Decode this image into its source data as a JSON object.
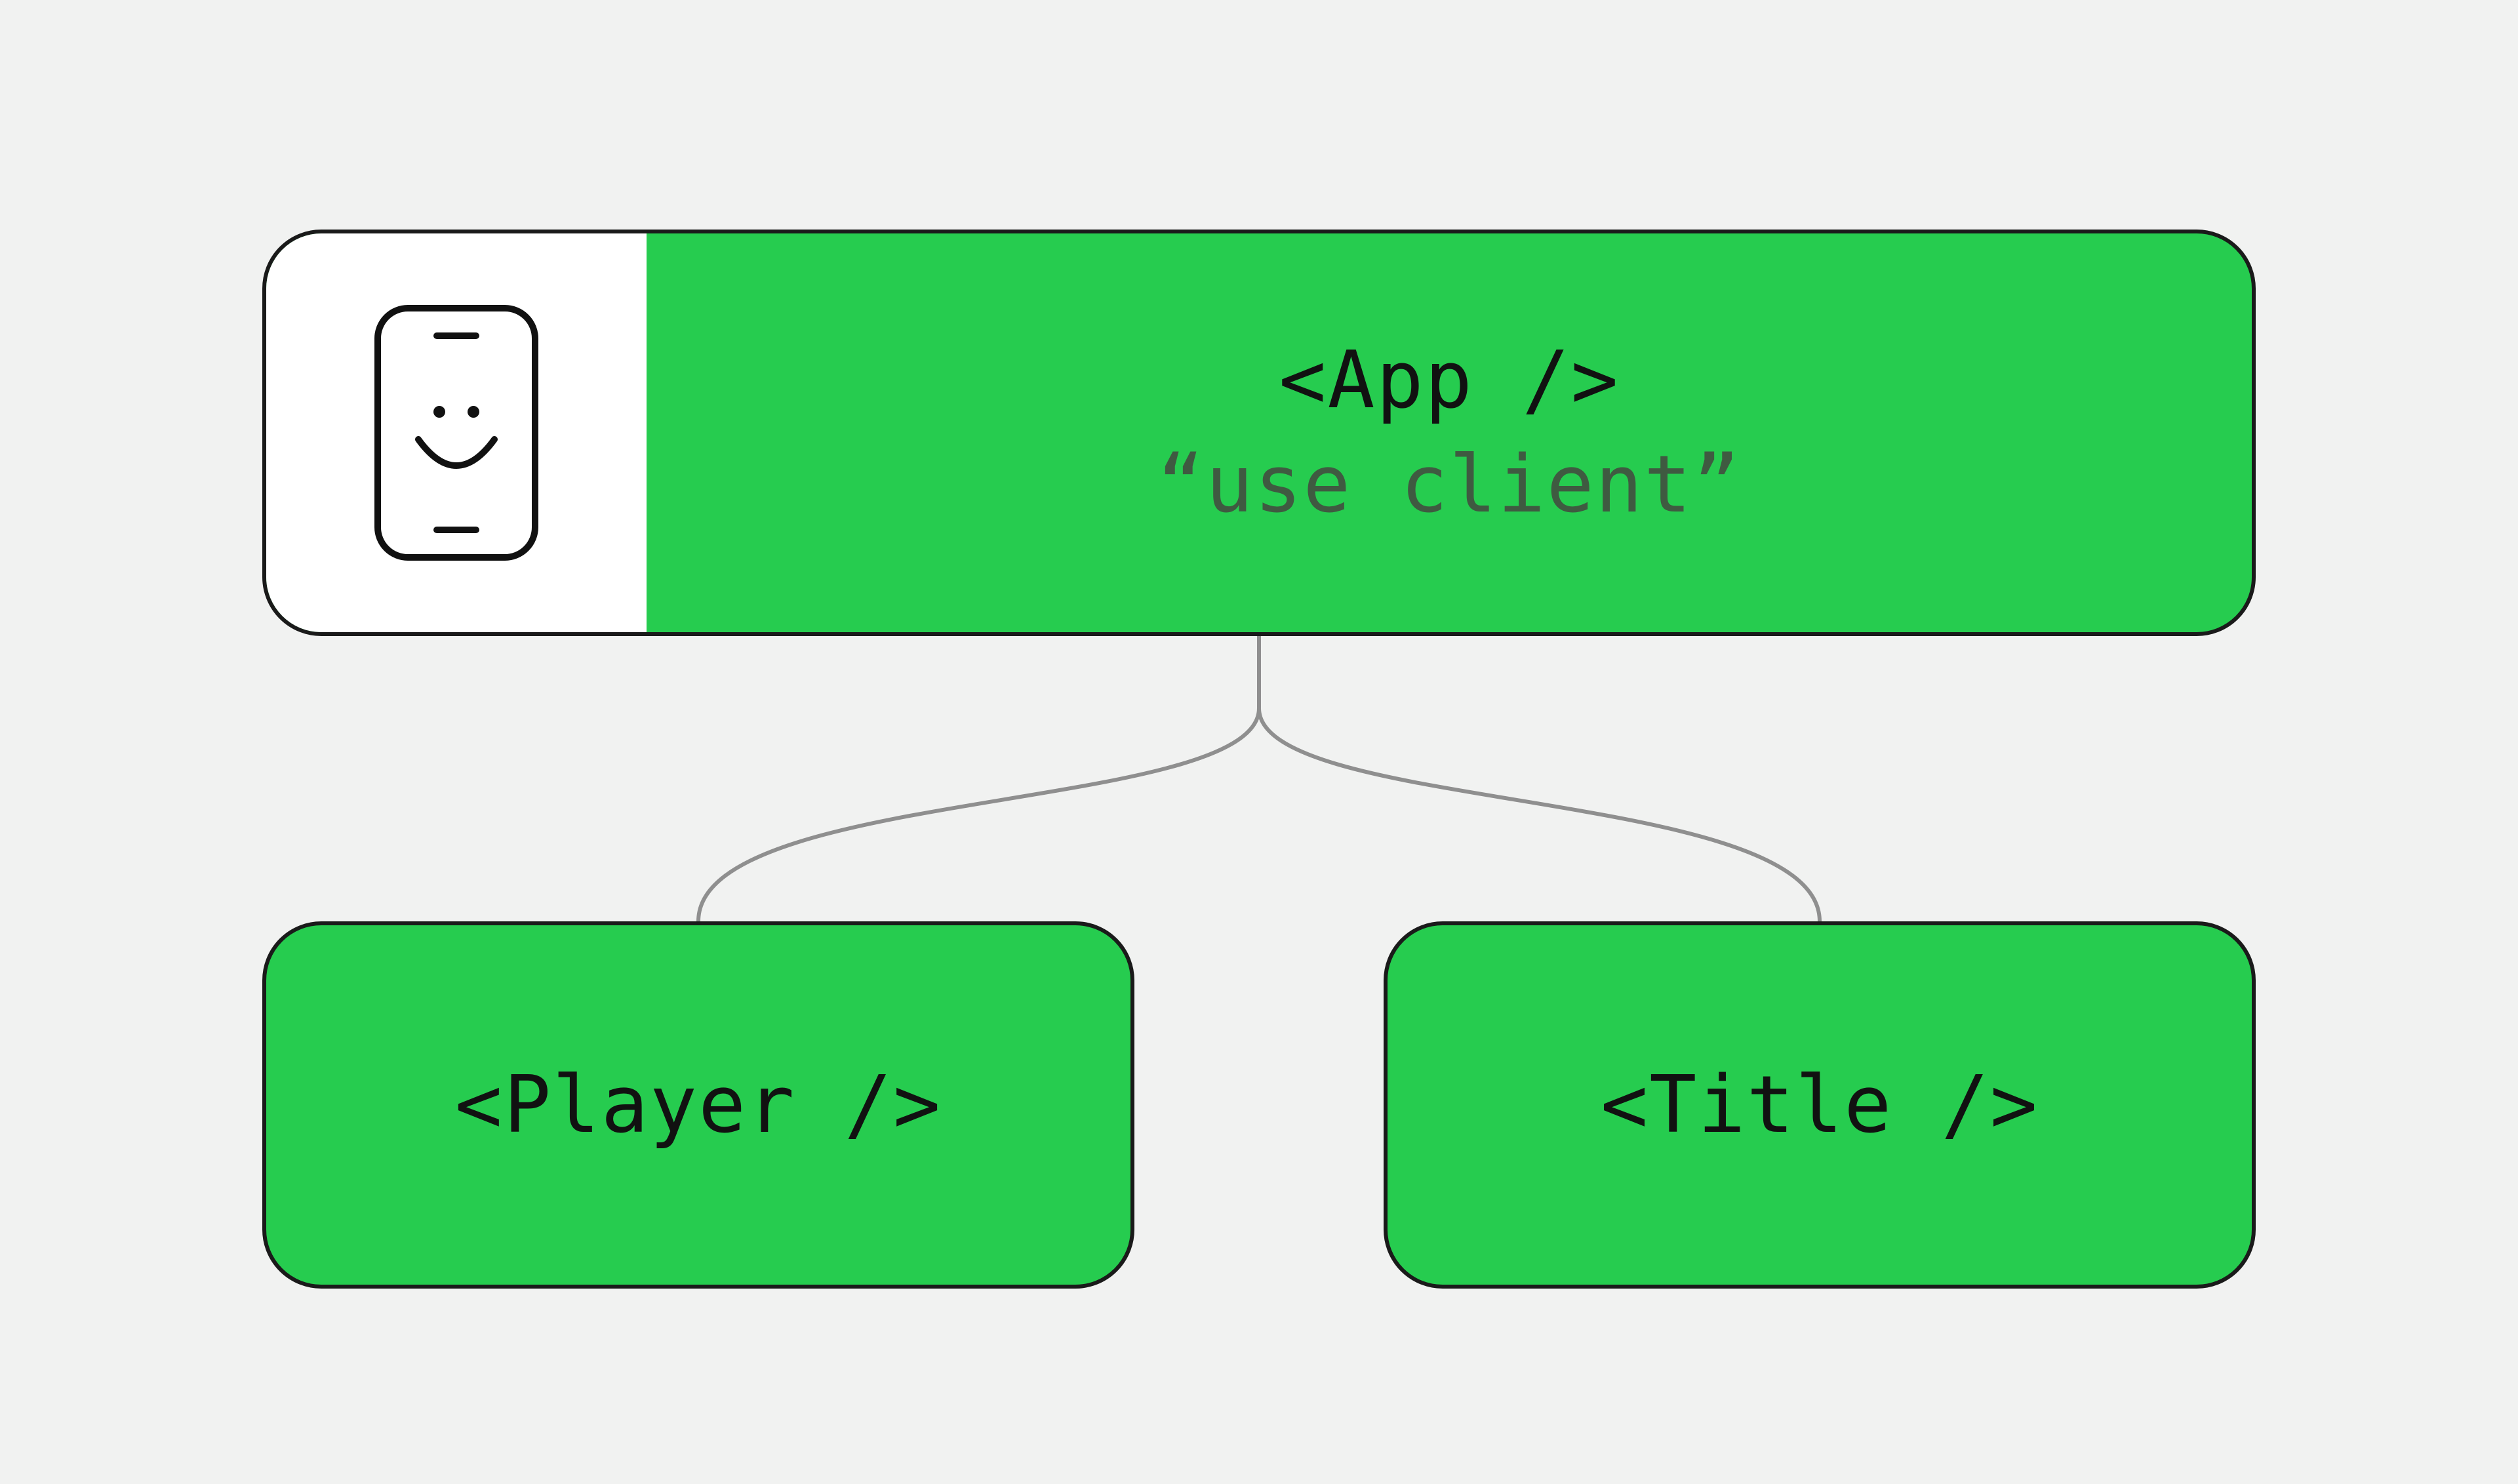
{
  "app": {
    "title": "<App />",
    "directive": "“use client”"
  },
  "children": {
    "player": {
      "label": "<Player />"
    },
    "title": {
      "label": "<Title />"
    }
  }
}
